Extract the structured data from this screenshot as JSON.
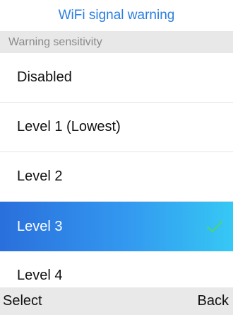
{
  "header": {
    "title": "WiFi signal warning"
  },
  "section": {
    "label": "Warning sensitivity"
  },
  "options": [
    {
      "label": "Disabled",
      "selected": false
    },
    {
      "label": "Level 1 (Lowest)",
      "selected": false
    },
    {
      "label": "Level 2",
      "selected": false
    },
    {
      "label": "Level 3",
      "selected": true,
      "icon": "check-icon"
    },
    {
      "label": "Level 4",
      "selected": false
    }
  ],
  "softkeys": {
    "left": "Select",
    "right": "Back"
  },
  "colors": {
    "title": "#2b7fe0",
    "selected_start": "#2a6fdc",
    "selected_end": "#36c8f4",
    "check": "#4cd964"
  }
}
